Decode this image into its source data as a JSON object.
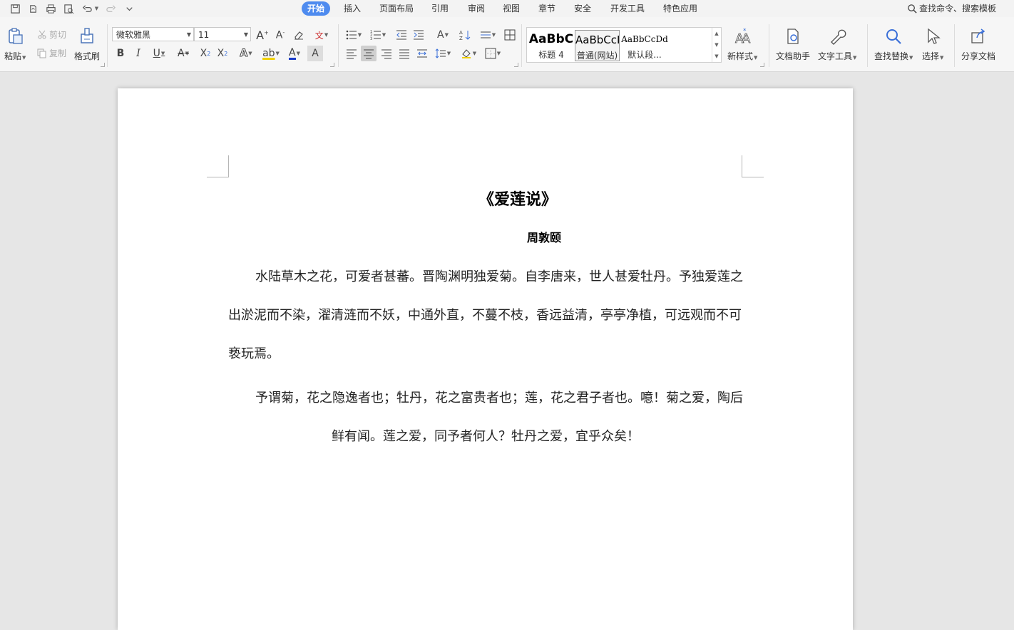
{
  "menu": {
    "tabs": [
      "开始",
      "插入",
      "页面布局",
      "引用",
      "审阅",
      "视图",
      "章节",
      "安全",
      "开发工具",
      "特色应用"
    ],
    "active_tab": "开始",
    "search_command": "查找命令、搜索模板"
  },
  "ribbon": {
    "paste": "粘贴",
    "cut": "剪切",
    "copy": "复制",
    "format_painter": "格式刷",
    "font_name": "微软雅黑",
    "font_size": "11",
    "styles": [
      {
        "sample": "AaBbC",
        "name": "标题 4"
      },
      {
        "sample": "AaBbCcI",
        "name": "普通(网站)"
      },
      {
        "sample": "AaBbCcDd",
        "name": "默认段..."
      }
    ],
    "new_style": "新样式",
    "doc_assistant": "文档助手",
    "text_tools": "文字工具",
    "find_replace": "查找替换",
    "select": "选择",
    "share_doc": "分享文档",
    "colors": {
      "accent": "#4e8bef",
      "font_color": "#1a3cc8",
      "highlight": "#f0d000"
    }
  },
  "document": {
    "title": "《爱莲说》",
    "author": "周敦颐",
    "paragraph1": "水陆草木之花，可爱者甚蕃。晋陶渊明独爱菊。自李唐来，世人甚爱牡丹。予独爱莲之出淤泥而不染，濯清涟而不妖，中通外直，不蔓不枝，香远益清，亭亭净植，可远观而不可亵玩焉。",
    "paragraph2": "予谓菊，花之隐逸者也；牡丹，花之富贵者也；莲，花之君子者也。噫！菊之爱，陶后鲜有闻。莲之爱，同予者何人？牡丹之爱，宜乎众矣！"
  }
}
